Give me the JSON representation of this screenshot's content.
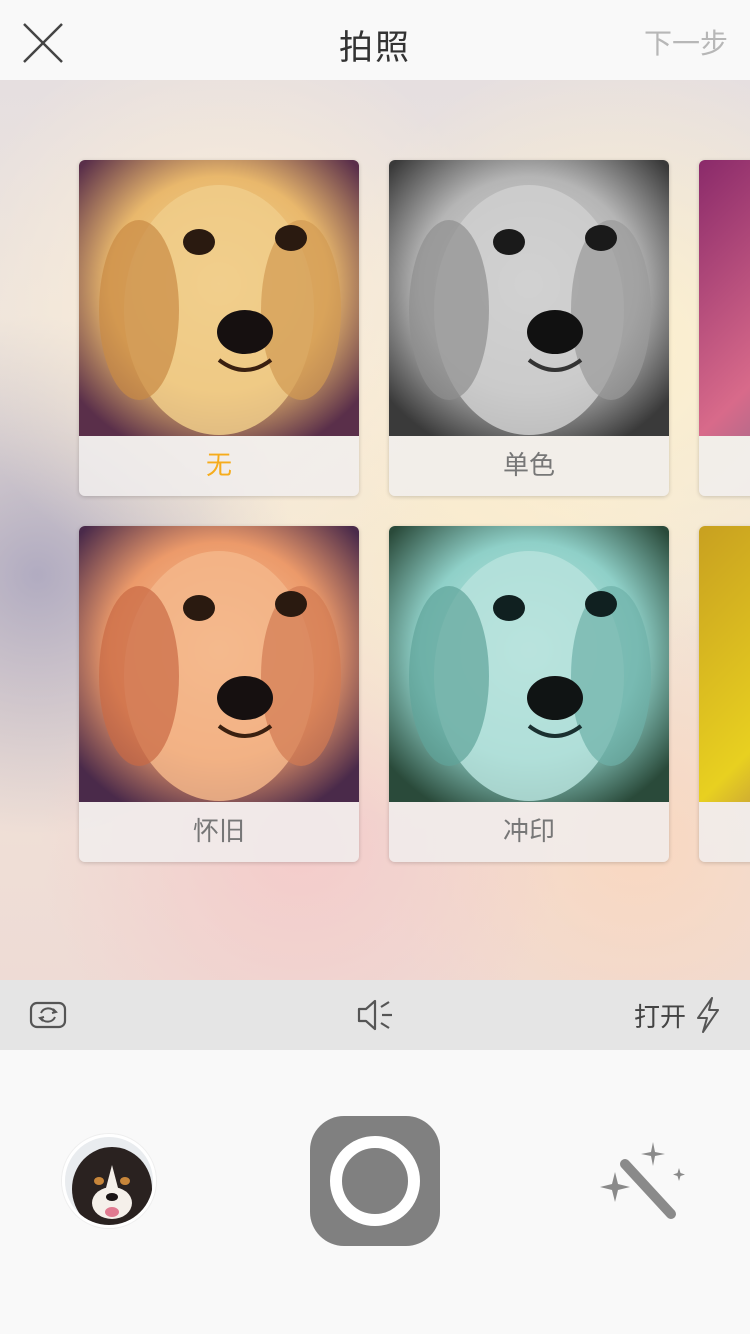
{
  "header": {
    "title": "拍照",
    "next_label": "下一步"
  },
  "filters": [
    {
      "label": "无",
      "selected": true,
      "tone": "warm"
    },
    {
      "label": "单色",
      "selected": false,
      "tone": "mono"
    },
    {
      "label": "",
      "selected": false,
      "tone": "magenta"
    },
    {
      "label": "怀旧",
      "selected": false,
      "tone": "nostalgia"
    },
    {
      "label": "冲印",
      "selected": false,
      "tone": "cyan"
    },
    {
      "label": "",
      "selected": false,
      "tone": "yellow-purple"
    }
  ],
  "controls": {
    "flash_label": "打开"
  },
  "colors": {
    "accent": "#f6ac1c",
    "shutter": "#808080"
  },
  "icons": {
    "close": "close-icon",
    "camera_switch": "camera-switch-icon",
    "sound": "sound-icon",
    "flash": "flash-icon",
    "magic": "magic-wand-icon"
  }
}
